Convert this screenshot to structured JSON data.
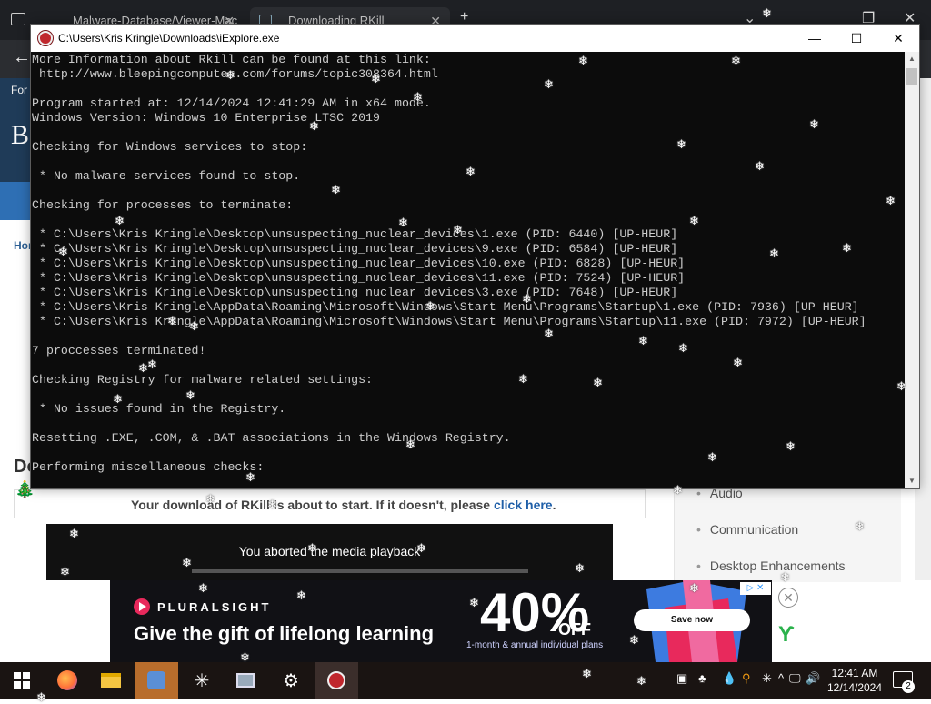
{
  "browser": {
    "tabs": [
      {
        "label": "Malware-Database/Viewer-Mac"
      },
      {
        "label": "Downloading RKill"
      }
    ],
    "nav_label": "For",
    "site_logo_letter": "B",
    "breadcrumb": "Hon",
    "doc_title_fragment": "Do",
    "download_notice": {
      "text": "Your download of RKill is about to start. If it doesn't, please ",
      "link": "click here",
      "suffix": "."
    },
    "video_message": "You aborted the media playback",
    "sidebar_items": [
      "Audio",
      "Communication",
      "Desktop Enhancements"
    ]
  },
  "ad": {
    "brand": "PLURALSIGHT",
    "headline": "Give the gift of lifelong learning",
    "percent": "40%",
    "off": "OFF",
    "subtext": "1-month & annual individual plans",
    "cta": "Save now"
  },
  "console": {
    "title": "C:\\Users\\Kris Kringle\\Downloads\\iExplore.exe",
    "lines": [
      "More Information about Rkill can be found at this link:",
      " http://www.bleepingcomputer.com/forums/topic308364.html",
      "",
      "Program started at: 12/14/2024 12:41:29 AM in x64 mode.",
      "Windows Version: Windows 10 Enterprise LTSC 2019",
      "",
      "Checking for Windows services to stop:",
      "",
      " * No malware services found to stop.",
      "",
      "Checking for processes to terminate:",
      "",
      " * C:\\Users\\Kris Kringle\\Desktop\\unsuspecting_nuclear_devices\\1.exe (PID: 6440) [UP-HEUR]",
      " * C:\\Users\\Kris Kringle\\Desktop\\unsuspecting_nuclear_devices\\9.exe (PID: 6584) [UP-HEUR]",
      " * C:\\Users\\Kris Kringle\\Desktop\\unsuspecting_nuclear_devices\\10.exe (PID: 6828) [UP-HEUR]",
      " * C:\\Users\\Kris Kringle\\Desktop\\unsuspecting_nuclear_devices\\11.exe (PID: 7524) [UP-HEUR]",
      " * C:\\Users\\Kris Kringle\\Desktop\\unsuspecting_nuclear_devices\\3.exe (PID: 7648) [UP-HEUR]",
      " * C:\\Users\\Kris Kringle\\AppData\\Roaming\\Microsoft\\Windows\\Start Menu\\Programs\\Startup\\1.exe (PID: 7936) [UP-HEUR]",
      " * C:\\Users\\Kris Kringle\\AppData\\Roaming\\Microsoft\\Windows\\Start Menu\\Programs\\Startup\\11.exe (PID: 7972) [UP-HEUR]",
      "",
      "7 proccesses terminated!",
      "",
      "Checking Registry for malware related settings:",
      "",
      " * No issues found in the Registry.",
      "",
      "Resetting .EXE, .COM, & .BAT associations in the Windows Registry.",
      "",
      "Performing miscellaneous checks:"
    ]
  },
  "taskbar": {
    "apps": [
      "start-icon",
      "firefox-icon",
      "file-explorer-icon",
      "app-icon",
      "snowflake-app-icon",
      "image-viewer-icon",
      "settings-icon",
      "rkill-icon"
    ],
    "clock_time": "12:41 AM",
    "clock_date": "12/14/2024",
    "notification_count": "2"
  },
  "colors": {
    "console_bg": "#0c0c0c",
    "console_text": "#cccccc",
    "taskbar_bg": "#1a1412",
    "link": "#1f5fa8",
    "pluralsight_pink": "#e8295c"
  }
}
